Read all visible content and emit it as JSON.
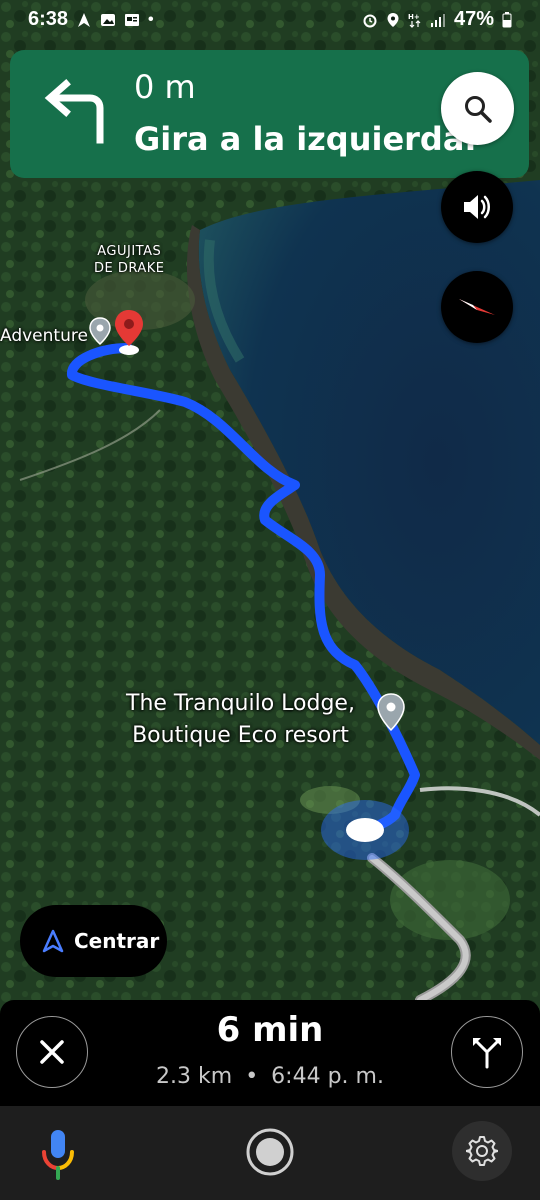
{
  "status_bar": {
    "time": "6:38",
    "battery": "47%",
    "icons_left": [
      "navigation-icon",
      "gallery-icon",
      "news-icon",
      "dot-icon"
    ],
    "icons_right": [
      "alarm-icon",
      "location-icon",
      "data-icon",
      "signal-icon",
      "battery-icon"
    ]
  },
  "navigation": {
    "distance": "0 m",
    "instruction": "Gira a la izquierda.",
    "turn_icon": "turn-left-arrow-icon"
  },
  "map": {
    "labels": {
      "town_line1": "AGUJITAS",
      "town_line2": "DE DRAKE",
      "poi_adventure": "Adventure",
      "lodge_line1": "The Tranquilo Lodge,",
      "lodge_line2": "Boutique Eco resort"
    },
    "colors": {
      "route": "#1a55ff",
      "forest": "#1f3a21",
      "sea": "#0d2b4a",
      "destination_pin": "#e53935"
    }
  },
  "controls": {
    "centrar_label": "Centrar",
    "search_icon": "search-icon",
    "sound_icon": "volume-icon",
    "compass_icon": "compass-icon"
  },
  "trip": {
    "duration": "6 min",
    "distance": "2.3 km",
    "separator": "•",
    "arrival_time": "6:44 p. m."
  },
  "colors": {
    "banner": "#16704b",
    "panel": "#000000",
    "nav_bar": "#1e1e1e"
  }
}
